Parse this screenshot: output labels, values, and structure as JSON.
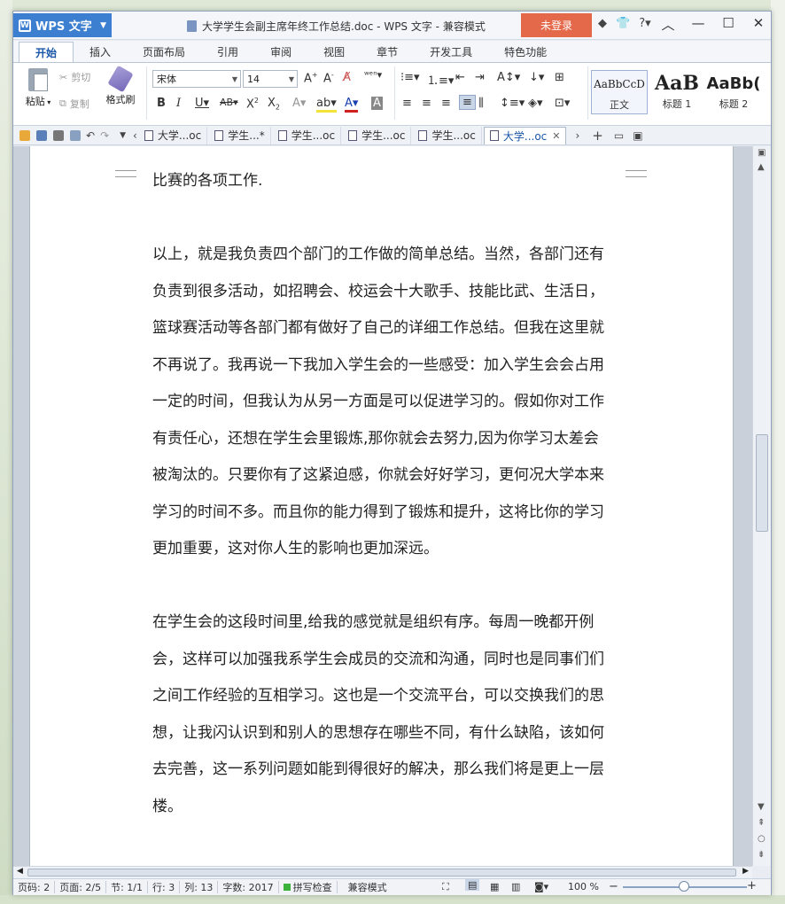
{
  "app": {
    "brand": "WPS 文字",
    "title": "大学学生会副主席年终工作总结.doc - WPS 文字 - 兼容模式",
    "login": "未登录"
  },
  "menu_tabs": [
    "开始",
    "插入",
    "页面布局",
    "引用",
    "审阅",
    "视图",
    "章节",
    "开发工具",
    "特色功能"
  ],
  "ribbon": {
    "paste": "粘贴",
    "cut": "剪切",
    "copy": "复制",
    "format_painter": "格式刷",
    "font_name": "宋体",
    "font_size": "14",
    "styles": [
      {
        "sample": "AaBbCcD",
        "label": "正文"
      },
      {
        "sample": "AaB",
        "label": "标题 1"
      },
      {
        "sample": "AaBb(",
        "label": "标题 2"
      }
    ]
  },
  "doc_tabs": [
    "大学...oc",
    "学生...*",
    "学生...oc",
    "学生...oc",
    "学生...oc",
    "大学...oc"
  ],
  "document": {
    "top_line": "比赛的各项工作.",
    "para1": [
      "以上，就是我负责四个部门的工作做的简单总结。当然，各部门还有",
      "负责到很多活动，如招聘会、校运会十大歌手、技能比武、生活日，",
      "篮球赛活动等各部门都有做好了自己的详细工作总结。但我在这里就",
      "不再说了。我再说一下我加入学生会的一些感受：加入学生会会占用",
      "一定的时间，但我认为从另一方面是可以促进学习的。假如你对工作",
      "有责任心，还想在学生会里锻炼,那你就会去努力,因为你学习太差会",
      "被淘汰的。只要你有了这紧迫感，你就会好好学习，更何况大学本来",
      "学习的时间不多。而且你的能力得到了锻炼和提升，这将比你的学习",
      "更加重要，这对你人生的影响也更加深远。"
    ],
    "para2": [
      "在学生会的这段时间里,给我的感觉就是组织有序。每周一晚都开例",
      "会，这样可以加强我系学生会成员的交流和沟通，同时也是同事们们",
      "之间工作经验的互相学习。这也是一个交流平台，可以交换我们的思",
      "想，让我闪认识到和别人的思想存在哪些不同，有什么缺陷，该如何",
      "去完善，这一系列问题如能到得很好的解决，那么我们将是更上一层",
      "楼。"
    ]
  },
  "status": {
    "page_num": "页码: 2",
    "pages": "页面: 2/5",
    "section": "节: 1/1",
    "row": "行: 3",
    "col": "列: 13",
    "words": "字数: 2017",
    "spell": "拼写检查",
    "mode": "兼容模式",
    "zoom": "100 %"
  }
}
